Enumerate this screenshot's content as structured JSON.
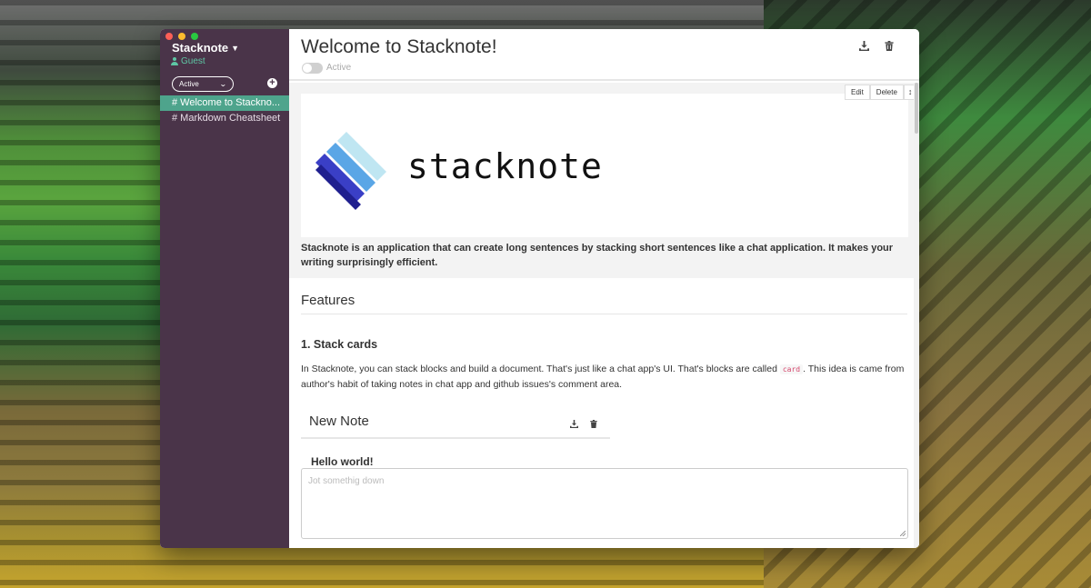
{
  "sidebar": {
    "app_title": "Stacknote",
    "user": "Guest",
    "filter": {
      "selected": "Active"
    },
    "notes": [
      {
        "label": "# Welcome to Stackno...",
        "active": true
      },
      {
        "label": "# Markdown Cheatsheet",
        "active": false
      }
    ]
  },
  "header": {
    "title": "Welcome to Stacknote!",
    "toggle_label": "Active"
  },
  "hero_card": {
    "toolbar": {
      "edit": "Edit",
      "delete": "Delete",
      "move": "↕"
    },
    "logo_text": "stacknote",
    "text": "Stacknote is an application that can create long sentences by stacking short sentences like a chat application. It makes your writing surprisingly efficient."
  },
  "content": {
    "features_heading": "Features",
    "stack_heading": "1. Stack cards",
    "para_before_code": "In Stacknote, you can stack blocks and build a document. That's just like a chat app's UI. That's blocks are called ",
    "code": "card",
    "para_after_code": ". This idea is came from author's habit of taking notes in chat app and github issues's comment area.",
    "mini_note_title": "New Note",
    "hello": "Hello world!",
    "editor_placeholder": "Jot somethig down"
  },
  "colors": {
    "sidebar_bg": "#4a3449",
    "accent": "#4ea48c",
    "user_color": "#5ec6a4"
  },
  "icons": [
    "download-icon",
    "trash-icon",
    "plus-circle-icon",
    "user-icon"
  ]
}
